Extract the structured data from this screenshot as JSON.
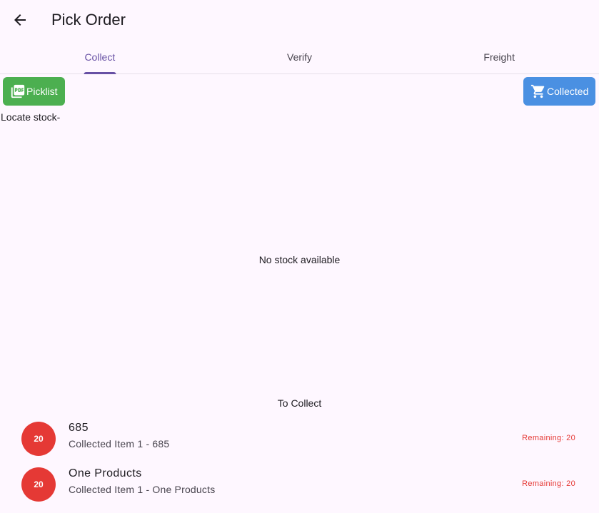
{
  "app_bar": {
    "title": "Pick Order",
    "back_icon": "arrow-back-icon"
  },
  "tabs": [
    {
      "label": "Collect",
      "active": true
    },
    {
      "label": "Verify",
      "active": false
    },
    {
      "label": "Freight",
      "active": false
    }
  ],
  "actions": {
    "picklist_label": "Picklist",
    "picklist_icon": "pdf-icon",
    "picklist_color": "#4caf50",
    "collected_label": "Collected",
    "collected_icon": "shopping-cart-icon",
    "collected_color": "#4a90e2"
  },
  "locate_stock_label": "Locate stock-",
  "empty_message": "No stock available",
  "to_collect": {
    "title": "To Collect",
    "items": [
      {
        "badge": "20",
        "title": "685",
        "subtitle": "Collected Item 1 - 685",
        "remaining": "Remaining: 20"
      },
      {
        "badge": "20",
        "title": "One Products",
        "subtitle": "Collected Item 1 - One Products",
        "remaining": "Remaining: 20"
      }
    ]
  },
  "colors": {
    "accent": "#6750a4",
    "badge": "#e53935",
    "background": "#fef7ff"
  }
}
